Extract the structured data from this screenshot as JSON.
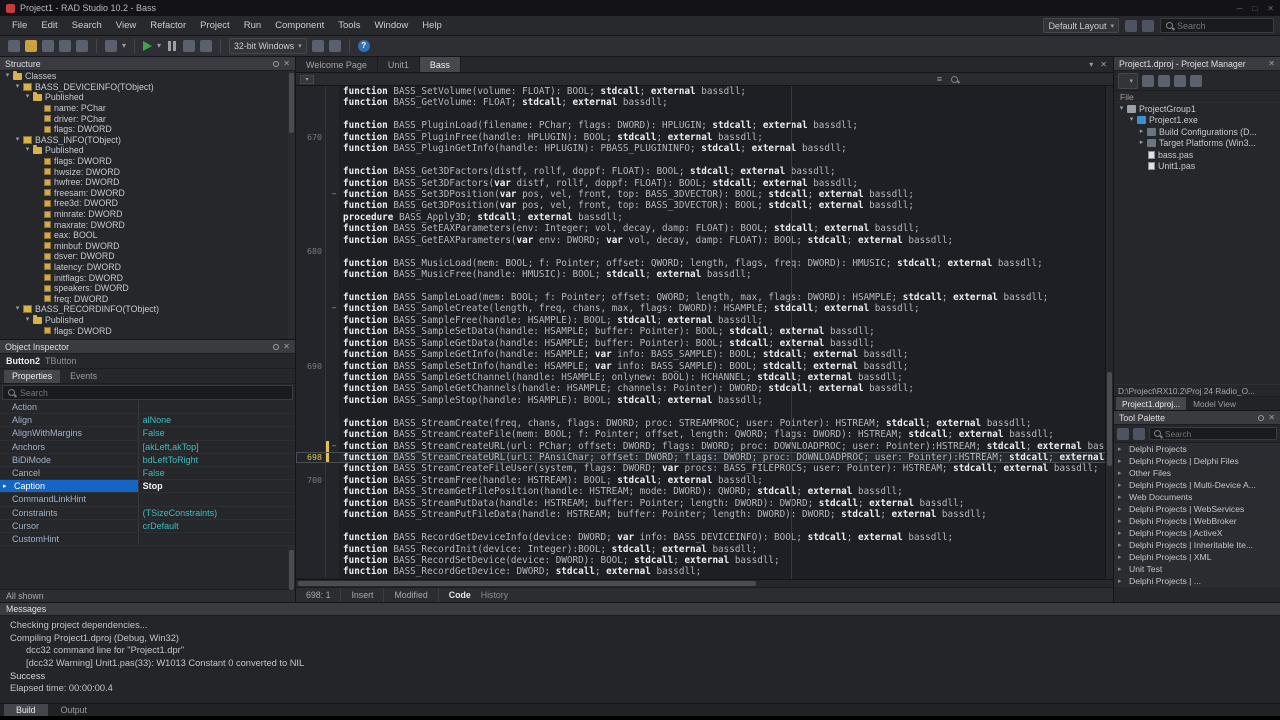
{
  "titlebar": {
    "title": "Project1 - RAD Studio 10.2 - Bass"
  },
  "menubar": {
    "items": [
      "File",
      "Edit",
      "Search",
      "View",
      "Refactor",
      "Project",
      "Run",
      "Component",
      "Tools",
      "Window",
      "Help"
    ],
    "layout_select": "Default Layout",
    "search_placeholder": "Search",
    "icons": [
      {
        "name": "save-layout-icon"
      },
      {
        "name": "delete-layout-icon"
      }
    ]
  },
  "toolbar": {
    "items": [
      {
        "type": "square",
        "name": "file-new-icon",
        "color": "#5b616c"
      },
      {
        "type": "square",
        "name": "folder-open-icon",
        "color": "#c9a23f"
      },
      {
        "type": "square",
        "name": "open-project-icon",
        "color": "#5b616c"
      },
      {
        "type": "square",
        "name": "save-icon",
        "color": "#5b616c"
      },
      {
        "type": "square",
        "name": "save-all-icon",
        "color": "#5b616c"
      },
      {
        "type": "sep"
      },
      {
        "type": "square",
        "name": "desktop-layout-icon",
        "color": "#5b616c"
      },
      {
        "type": "caret",
        "name": "desktop-layout-caret-icon"
      },
      {
        "type": "sep"
      },
      {
        "type": "triangle",
        "name": "run-icon",
        "color": "#3fa44a"
      },
      {
        "type": "caret",
        "name": "run-options-caret-icon"
      },
      {
        "type": "pause",
        "name": "pause-icon",
        "color": "#9aa0a6"
      },
      {
        "type": "square",
        "name": "trace-into-icon",
        "color": "#5b616c"
      },
      {
        "type": "square",
        "name": "step-over-icon",
        "color": "#5b616c"
      },
      {
        "type": "sep"
      },
      {
        "type": "combo",
        "name": "target-platform-select",
        "label": "32-bit Windows"
      },
      {
        "type": "square",
        "name": "project-options-icon",
        "color": "#5b616c"
      },
      {
        "type": "square",
        "name": "build-icon",
        "color": "#5b616c"
      },
      {
        "type": "sep"
      },
      {
        "type": "help",
        "name": "help-icon",
        "label": "?"
      }
    ]
  },
  "structure_panel": {
    "title": "Structure",
    "tree": [
      {
        "depth": 0,
        "label": "Classes",
        "icon": "folder",
        "expander": "open"
      },
      {
        "depth": 1,
        "label": "BASS_DEVICEINFO(TObject)",
        "icon": "class",
        "expander": "open"
      },
      {
        "depth": 2,
        "label": "Published",
        "icon": "folder",
        "expander": "open"
      },
      {
        "depth": 3,
        "label": "name: PChar",
        "icon": "field",
        "expander": "none"
      },
      {
        "depth": 3,
        "label": "driver: PChar",
        "icon": "field",
        "expander": "none"
      },
      {
        "depth": 3,
        "label": "flags: DWORD",
        "icon": "field",
        "expander": "none"
      },
      {
        "depth": 1,
        "label": "BASS_INFO(TObject)",
        "icon": "class",
        "expander": "open"
      },
      {
        "depth": 2,
        "label": "Published",
        "icon": "folder",
        "expander": "open"
      },
      {
        "depth": 3,
        "label": "flags: DWORD",
        "icon": "field",
        "expander": "none"
      },
      {
        "depth": 3,
        "label": "hwsize: DWORD",
        "icon": "field",
        "expander": "none"
      },
      {
        "depth": 3,
        "label": "hwfree: DWORD",
        "icon": "field",
        "expander": "none"
      },
      {
        "depth": 3,
        "label": "freesam: DWORD",
        "icon": "field",
        "expander": "none"
      },
      {
        "depth": 3,
        "label": "free3d: DWORD",
        "icon": "field",
        "expander": "none"
      },
      {
        "depth": 3,
        "label": "minrate: DWORD",
        "icon": "field",
        "expander": "none"
      },
      {
        "depth": 3,
        "label": "maxrate: DWORD",
        "icon": "field",
        "expander": "none"
      },
      {
        "depth": 3,
        "label": "eax: BOOL",
        "icon": "field",
        "expander": "none"
      },
      {
        "depth": 3,
        "label": "minbuf: DWORD",
        "icon": "field",
        "expander": "none"
      },
      {
        "depth": 3,
        "label": "dsver: DWORD",
        "icon": "field",
        "expander": "none"
      },
      {
        "depth": 3,
        "label": "latency: DWORD",
        "icon": "field",
        "expander": "none"
      },
      {
        "depth": 3,
        "label": "initflags: DWORD",
        "icon": "field",
        "expander": "none"
      },
      {
        "depth": 3,
        "label": "speakers: DWORD",
        "icon": "field",
        "expander": "none"
      },
      {
        "depth": 3,
        "label": "freq: DWORD",
        "icon": "field",
        "expander": "none"
      },
      {
        "depth": 1,
        "label": "BASS_RECORDINFO(TObject)",
        "icon": "class",
        "expander": "open"
      },
      {
        "depth": 2,
        "label": "Published",
        "icon": "folder",
        "expander": "open"
      },
      {
        "depth": 3,
        "label": "flags: DWORD",
        "icon": "field",
        "expander": "none"
      }
    ]
  },
  "object_inspector": {
    "title": "Object Inspector",
    "instance": "Button2",
    "type": "TButton",
    "tabs": [
      {
        "label": "Properties",
        "active": true
      },
      {
        "label": "Events",
        "active": false
      }
    ],
    "search_placeholder": "Search",
    "properties": [
      {
        "name": "Action",
        "value": ""
      },
      {
        "name": "Align",
        "value": "alNone"
      },
      {
        "name": "AlignWithMargins",
        "value": "False"
      },
      {
        "name": "Anchors",
        "value": "[akLeft,akTop]"
      },
      {
        "name": "BiDiMode",
        "value": "bdLeftToRight"
      },
      {
        "name": "Cancel",
        "value": "False"
      },
      {
        "name": "Caption",
        "value": "Stop",
        "selected": true
      },
      {
        "name": "CommandLinkHint",
        "value": ""
      },
      {
        "name": "Constraints",
        "value": "(TSizeConstraints)"
      },
      {
        "name": "Cursor",
        "value": "crDefault"
      },
      {
        "name": "CustomHint",
        "value": ""
      }
    ],
    "footer": "All shown"
  },
  "editor": {
    "tabs": [
      {
        "label": "Welcome Page",
        "active": false
      },
      {
        "label": "Unit1",
        "active": false
      },
      {
        "label": "Bass",
        "active": true
      }
    ],
    "status": {
      "position": "698: 1",
      "mode": "Insert",
      "modified": "Modified",
      "view_code": "Code",
      "view_history": "History"
    },
    "code": {
      "first_line": 666,
      "current_line": 698,
      "changed_lines": [
        697,
        698
      ],
      "fold_lines": [
        675,
        685,
        697
      ],
      "lines": [
        "function BASS_SetVolume(volume: FLOAT): BOOL; stdcall; external bassdll;",
        "function BASS_GetVolume: FLOAT; stdcall; external bassdll;",
        "",
        "function BASS_PluginLoad(filename: PChar; flags: DWORD): HPLUGIN; stdcall; external bassdll;",
        "function BASS_PluginFree(handle: HPLUGIN): BOOL; stdcall; external bassdll;",
        "function BASS_PluginGetInfo(handle: HPLUGIN): PBASS_PLUGININFO; stdcall; external bassdll;",
        "",
        "function BASS_Get3DFactors(distf, rollf, doppf: FLOAT): BOOL; stdcall; external bassdll;",
        "function BASS_Set3DFactors(var distf, rollf, doppf: FLOAT): BOOL; stdcall; external bassdll;",
        "function BASS_Set3DPosition(var pos, vel, front, top: BASS_3DVECTOR): BOOL; stdcall; external bassdll;",
        "function BASS_Get3DPosition(var pos, vel, front, top: BASS_3DVECTOR): BOOL; stdcall; external bassdll;",
        "procedure BASS_Apply3D; stdcall; external bassdll;",
        "function BASS_SetEAXParameters(env: Integer; vol, decay, damp: FLOAT): BOOL; stdcall; external bassdll;",
        "function BASS_GetEAXParameters(var env: DWORD; var vol, decay, damp: FLOAT): BOOL; stdcall; external bassdll;",
        "",
        "function BASS_MusicLoad(mem: BOOL; f: Pointer; offset: QWORD; length, flags, freq: DWORD): HMUSIC; stdcall; external bassdll;",
        "function BASS_MusicFree(handle: HMUSIC): BOOL; stdcall; external bassdll;",
        "",
        "function BASS_SampleLoad(mem: BOOL; f: Pointer; offset: QWORD; length, max, flags: DWORD): HSAMPLE; stdcall; external bassdll;",
        "function BASS_SampleCreate(length, freq, chans, max, flags: DWORD): HSAMPLE; stdcall; external bassdll;",
        "function BASS_SampleFree(handle: HSAMPLE): BOOL; stdcall; external bassdll;",
        "function BASS_SampleSetData(handle: HSAMPLE; buffer: Pointer): BOOL; stdcall; external bassdll;",
        "function BASS_SampleGetData(handle: HSAMPLE; buffer: Pointer): BOOL; stdcall; external bassdll;",
        "function BASS_SampleGetInfo(handle: HSAMPLE; var info: BASS_SAMPLE): BOOL; stdcall; external bassdll;",
        "function BASS_SampleSetInfo(handle: HSAMPLE; var info: BASS_SAMPLE): BOOL; stdcall; external bassdll;",
        "function BASS_SampleGetChannel(handle: HSAMPLE; onlynew: BOOL): HCHANNEL; stdcall; external bassdll;",
        "function BASS_SampleGetChannels(handle: HSAMPLE; channels: Pointer): DWORD; stdcall; external bassdll;",
        "function BASS_SampleStop(handle: HSAMPLE): BOOL; stdcall; external bassdll;",
        "",
        "function BASS_StreamCreate(freq, chans, flags: DWORD; proc: STREAMPROC; user: Pointer): HSTREAM; stdcall; external bassdll;",
        "function BASS_StreamCreateFile(mem: BOOL; f: Pointer; offset, length: QWORD; flags: DWORD): HSTREAM; stdcall; external bassdll;",
        "function BASS_StreamCreateURL(url: PChar; offset: DWORD; flags: DWORD; proc: DOWNLOADPROC; user: Pointer):HSTREAM; stdcall; external bassdll;",
        "function BASS_StreamCreateURL(url: PAnsiChar; offset: DWORD; flags: DWORD; proc: DOWNLOADPROC; user: Pointer):HSTREAM; stdcall; external bassdll;",
        "function BASS_StreamCreateFileUser(system, flags: DWORD; var procs: BASS_FILEPROCS; user: Pointer): HSTREAM; stdcall; external bassdll;",
        "function BASS_StreamFree(handle: HSTREAM): BOOL; stdcall; external bassdll;",
        "function BASS_StreamGetFilePosition(handle: HSTREAM; mode: DWORD): QWORD; stdcall; external bassdll;",
        "function BASS_StreamPutData(handle: HSTREAM; buffer: Pointer; length: DWORD): DWORD; stdcall; external bassdll;",
        "function BASS_StreamPutFileData(handle: HSTREAM; buffer: Pointer; length: DWORD): DWORD; stdcall; external bassdll;",
        "",
        "function BASS_RecordGetDeviceInfo(device: DWORD; var info: BASS_DEVICEINFO): BOOL; stdcall; external bassdll;",
        "function BASS_RecordInit(device: Integer):BOOL; stdcall; external bassdll;",
        "function BASS_RecordSetDevice(device: DWORD): BOOL; stdcall; external bassdll;",
        "function BASS_RecordGetDevice: DWORD; stdcall; external bassdll;"
      ]
    }
  },
  "project_manager": {
    "title": "Project1.dproj - Project Manager",
    "toolbar_icons": [
      {
        "type": "combo",
        "name": "pm-menu-select",
        "label": ""
      },
      {
        "type": "square",
        "name": "pm-new-icon",
        "color": "#5b616c"
      },
      {
        "type": "square",
        "name": "pm-remove-icon",
        "color": "#5b616c"
      },
      {
        "type": "square",
        "name": "pm-sort-icon",
        "color": "#5b616c"
      },
      {
        "type": "square",
        "name": "pm-collapse-icon",
        "color": "#5b616c"
      }
    ],
    "column_header": "File",
    "tree": [
      {
        "depth": 0,
        "label": "ProjectGroup1",
        "icon": "group",
        "expander": "open"
      },
      {
        "depth": 1,
        "label": "Project1.exe",
        "icon": "exe",
        "expander": "open"
      },
      {
        "depth": 2,
        "label": "Build Configurations (D...",
        "icon": "config",
        "expander": "closed"
      },
      {
        "depth": 2,
        "label": "Target Platforms (Win3...",
        "icon": "config",
        "expander": "closed"
      },
      {
        "depth": 2,
        "label": "bass.pas",
        "icon": "pas",
        "expander": "none"
      },
      {
        "depth": 2,
        "label": "Unit1.pas",
        "icon": "pas",
        "expander": "none"
      }
    ],
    "path": "D:\\Project\\RX10.2\\Proj 24 Radio_O...",
    "tabs": [
      {
        "label": "Project1.dproj...",
        "active": true
      },
      {
        "label": "Model View",
        "active": false
      }
    ]
  },
  "tool_palette": {
    "title": "Tool Palette",
    "toolbar_icons": [
      {
        "type": "square",
        "name": "palette-menu-icon",
        "color": "#5b616c"
      },
      {
        "type": "square",
        "name": "palette-collapse-icon",
        "color": "#5b616c"
      }
    ],
    "search_placeholder": "Search",
    "categories": [
      "Delphi Projects",
      "Delphi Projects | Delphi Files",
      "Other Files",
      "Delphi Projects | Multi-Device A...",
      "Web Documents",
      "Delphi Projects | WebServices",
      "Delphi Projects | WebBroker",
      "Delphi Projects | ActiveX",
      "Delphi Projects | Inheritable Ite...",
      "Delphi Projects | XML",
      "Unit Test",
      "Delphi Projects | ..."
    ]
  },
  "messages": {
    "title": "Messages",
    "lines": [
      {
        "text": "Checking project dependencies...",
        "indent": 0,
        "emphasis": false
      },
      {
        "text": "Compiling Project1.dproj (Debug, Win32)",
        "indent": 0,
        "emphasis": false
      },
      {
        "text": "dcc32 command line for \"Project1.dpr\"",
        "indent": 1,
        "emphasis": false
      },
      {
        "text": "[dcc32 Warning] Unit1.pas(33): W1013 Constant 0 converted to NIL",
        "indent": 1,
        "emphasis": false
      },
      {
        "text": "Success",
        "indent": 0,
        "emphasis": true
      },
      {
        "text": "Elapsed time: 00:00:00.4",
        "indent": 0,
        "emphasis": false
      }
    ]
  },
  "bottom_tabs": [
    {
      "label": "Build",
      "active": true
    },
    {
      "label": "Output",
      "active": false
    }
  ],
  "window_controls": {
    "minimize": "─",
    "maximize": "□",
    "close": "✕"
  }
}
